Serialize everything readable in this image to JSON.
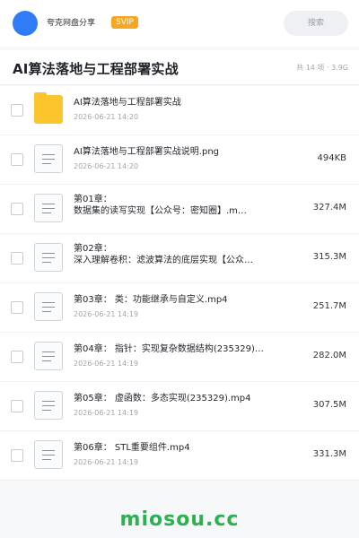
{
  "header": {
    "brand": "夸克网盘分享",
    "badge": "SVIP",
    "search_label": "搜索"
  },
  "folder": {
    "title": "AI算法落地与工程部署实战",
    "summary": "共 14 项 · 3.9G"
  },
  "files": [
    {
      "type": "folder",
      "name": "AI算法落地与工程部署实战",
      "date": "2026-06-21 14:20",
      "size": ""
    },
    {
      "type": "file",
      "name": "AI算法落地与工程部署实战说明.png",
      "date": "2026-06-21 14:20",
      "size": "494KB"
    },
    {
      "type": "file",
      "name": "第01章：\n数据集的读写实现【公众号：密知圈】.m…",
      "date": "",
      "size": "327.4M"
    },
    {
      "type": "file",
      "name": "第02章：\n深入理解卷积：滤波算法的底层实现【公众…",
      "date": "",
      "size": "315.3M"
    },
    {
      "type": "file",
      "name": "第03章： 类：功能继承与自定义.mp4",
      "date": "2026-06-21 14:19",
      "size": "251.7M"
    },
    {
      "type": "file",
      "name": "第04章： 指针：实现复杂数据结构(235329)…",
      "date": "2026-06-21 14:19",
      "size": "282.0M"
    },
    {
      "type": "file",
      "name": "第05章： 虚函数：多态实现(235329).mp4",
      "date": "2026-06-21 14:19",
      "size": "307.5M"
    },
    {
      "type": "file",
      "name": "第06章： STL重要组件.mp4",
      "date": "2026-06-21 14:19",
      "size": "331.3M"
    }
  ],
  "footer": {
    "watermark": "miosou.cc"
  }
}
